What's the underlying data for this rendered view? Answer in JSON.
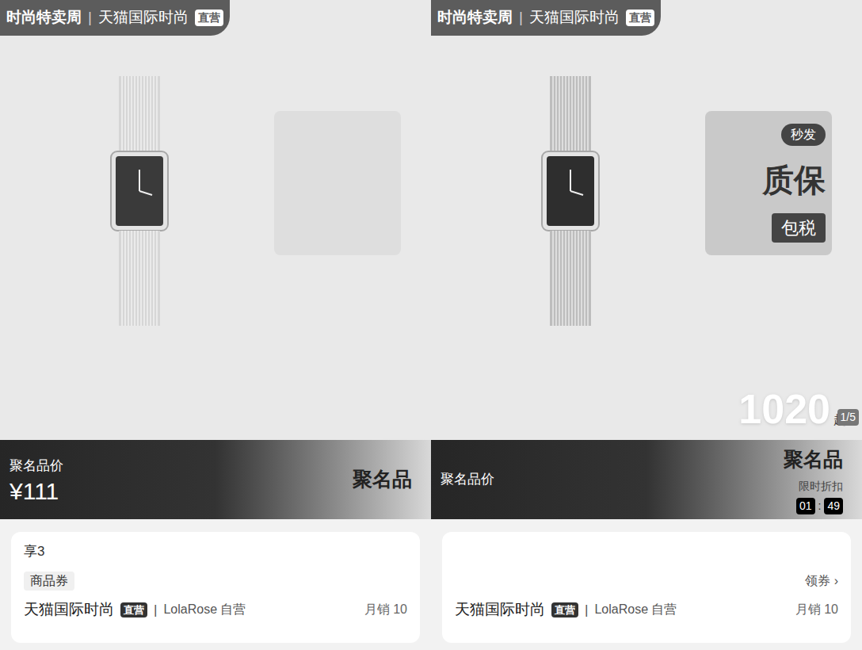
{
  "panels": [
    {
      "badge": {
        "event": "时尚特卖周",
        "channel": "天猫国际时尚",
        "tag": "直营"
      },
      "overlay": {
        "faded": true,
        "top": "",
        "main": "",
        "bottom": ""
      },
      "price_banner": {
        "amount": "",
        "suffix": "",
        "pager": ""
      },
      "band": {
        "label": "聚名品价",
        "price": "¥111",
        "brand": "聚名品",
        "promo": "",
        "countdown": []
      },
      "card": {
        "benefit": "享3",
        "coupon": "商品券",
        "coupon_action": "",
        "store": "天猫国际时尚",
        "store_tag": "直营",
        "separator": "|",
        "seller": "LolaRose 自营",
        "sales": "月销 10"
      }
    },
    {
      "badge": {
        "event": "时尚特卖周",
        "channel": "天猫国际时尚",
        "tag": "直营"
      },
      "overlay": {
        "faded": false,
        "top": "秒发",
        "main": "质保",
        "bottom": "包税"
      },
      "price_banner": {
        "amount": "1020",
        "suffix": "起",
        "pager": "1/5"
      },
      "band": {
        "label": "聚名品价",
        "price": "",
        "brand": "聚名品",
        "promo": "限时折扣",
        "countdown": [
          "01",
          ":",
          "49"
        ]
      },
      "card": {
        "benefit": "",
        "coupon": "",
        "coupon_action": "领券 ›",
        "store": "天猫国际时尚",
        "store_tag": "直营",
        "separator": "|",
        "seller": "LolaRose 自营",
        "sales": "月销 10"
      }
    }
  ]
}
